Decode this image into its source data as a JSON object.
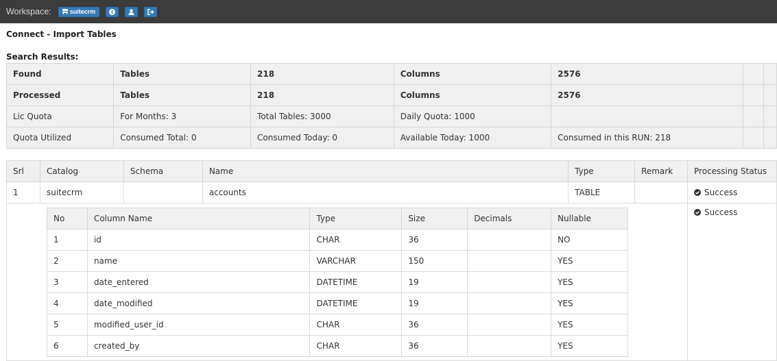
{
  "topbar": {
    "workspace_label": "Workspace:",
    "workspace_name": "suitecrm",
    "buttons": [
      {
        "icon": "info-icon"
      },
      {
        "icon": "user-icon"
      },
      {
        "icon": "sign-out-icon"
      }
    ]
  },
  "page_title": "Connect - Import Tables",
  "search_results_title": "Search Results:",
  "summary": {
    "rows": [
      [
        "Found",
        "Tables",
        "218",
        "Columns",
        "2576",
        "",
        ""
      ],
      [
        "Processed",
        "Tables",
        "218",
        "Columns",
        "2576",
        "",
        ""
      ],
      [
        "Lic Quota",
        "For Months: 3",
        "Total Tables: 3000",
        "Daily Quota: 1000",
        "",
        "",
        ""
      ],
      [
        "Quota Utilized",
        "Consumed Total: 0",
        "Consumed Today: 0",
        "Available Today: 1000",
        "Consumed in this RUN: 218",
        "",
        ""
      ]
    ]
  },
  "results": {
    "headers": [
      "Srl",
      "Catalog",
      "Schema",
      "Name",
      "Type",
      "Remark",
      "Processing Status"
    ],
    "row": {
      "srl": "1",
      "catalog": "suitecrm",
      "schema": "",
      "name": "accounts",
      "type": "TABLE",
      "remark": "",
      "status": "Success"
    },
    "detail_status": "Success"
  },
  "columns_table": {
    "headers": [
      "No",
      "Column Name",
      "Type",
      "Size",
      "Decimals",
      "Nullable"
    ],
    "rows": [
      [
        "1",
        "id",
        "CHAR",
        "36",
        "",
        "NO"
      ],
      [
        "2",
        "name",
        "VARCHAR",
        "150",
        "",
        "YES"
      ],
      [
        "3",
        "date_entered",
        "DATETIME",
        "19",
        "",
        "YES"
      ],
      [
        "4",
        "date_modified",
        "DATETIME",
        "19",
        "",
        "YES"
      ],
      [
        "5",
        "modified_user_id",
        "CHAR",
        "36",
        "",
        "YES"
      ],
      [
        "6",
        "created_by",
        "CHAR",
        "36",
        "",
        "YES"
      ]
    ]
  },
  "colors": {
    "topbar_bg": "#3b3b3b",
    "button_bg": "#337ab7",
    "header_cell_bg": "#f0f0f0"
  }
}
